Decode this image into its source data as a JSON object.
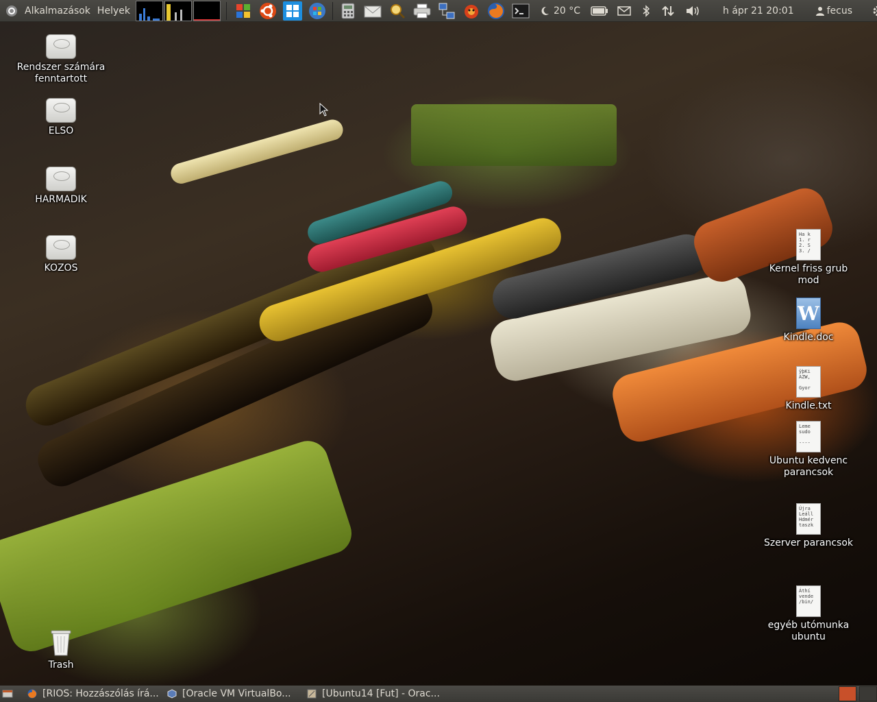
{
  "top_panel": {
    "menu_applications": "Alkalmazások",
    "menu_places": "Helyek",
    "launchers": [
      "windows-xp-icon",
      "ubuntu-icon",
      "windows-8-icon",
      "windows-7-icon",
      "calculator-icon",
      "mail-icon",
      "magnifier-icon",
      "printer-icon",
      "network-icon",
      "game-icon",
      "firefox-icon",
      "terminal-icon"
    ],
    "weather": "20 °C",
    "clock": "h ápr 21 20:01",
    "user": "fecus"
  },
  "desktop": {
    "left_icons": [
      {
        "label": "Rendszer számára fenntartott",
        "icon": "drive-icon"
      },
      {
        "label": "ELSO",
        "icon": "drive-icon"
      },
      {
        "label": "HARMADIK",
        "icon": "drive-icon"
      },
      {
        "label": "KOZOS",
        "icon": "drive-icon"
      }
    ],
    "trash_label": "Trash",
    "right_icons": [
      {
        "label": "Kernel friss grub mod",
        "preview": "Ha k\n1. r\n2. S\n3. /"
      },
      {
        "label": "Kindle.doc",
        "preview": "W"
      },
      {
        "label": "Kindle.txt",
        "preview": "ÿþKi\nAZW,\n\nGyor"
      },
      {
        "label": "Ubuntu kedvenc parancsok",
        "preview": "Leme\nsudo\n\n----"
      },
      {
        "label": "Szerver parancsok",
        "preview": "Újra\nLeáll\nHdmér\ntaszk"
      },
      {
        "label": "egyéb utómunka ubuntu",
        "preview": "Áthí\nvende\n/bin/"
      }
    ]
  },
  "taskbar": {
    "tasks": [
      {
        "label": "[RIOS: Hozzászólás írá..."
      },
      {
        "label": "[Oracle VM VirtualBo..."
      },
      {
        "label": "[Ubuntu14 [Fut] - Orac..."
      }
    ]
  },
  "colors": {
    "panel": "#3c3b37",
    "panel_text": "#dfdbd2",
    "accent_power": "#e0483a",
    "workspace_active": "#c8502a"
  }
}
